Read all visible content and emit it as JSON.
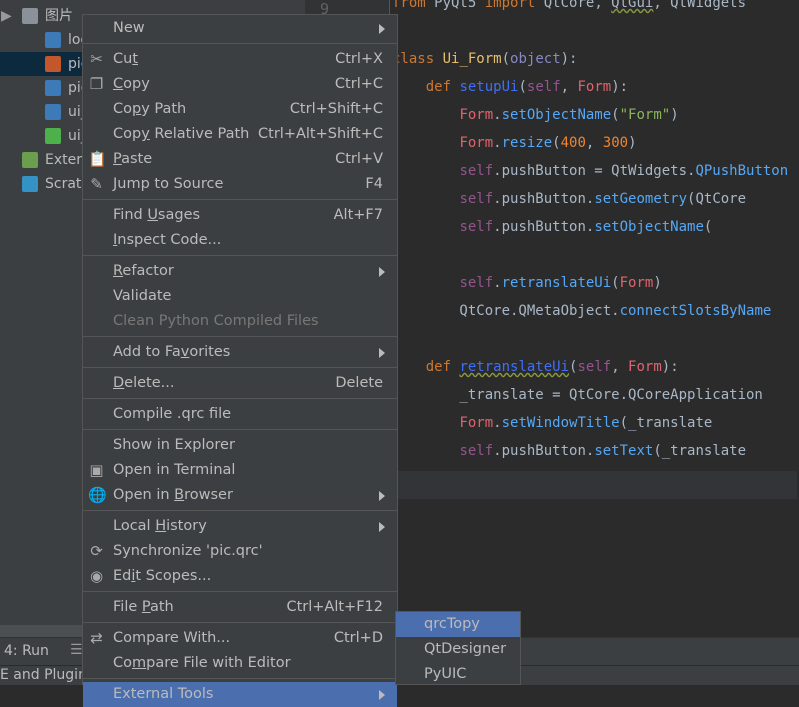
{
  "tree": {
    "items": [
      {
        "label": "图片",
        "icon": "folder-icon",
        "indent": 22
      },
      {
        "label": "logic_",
        "icon": "python-file-icon",
        "indent": 45
      },
      {
        "label": "pic.qrc",
        "icon": "qrc-file-icon",
        "indent": 45,
        "selected": true
      },
      {
        "label": "pic_rc",
        "icon": "python-file-icon",
        "indent": 45
      },
      {
        "label": "ui_set",
        "icon": "python-file-icon",
        "indent": 45
      },
      {
        "label": "ui_set",
        "icon": "qt-ui-file-icon",
        "indent": 45
      },
      {
        "label": "External",
        "icon": "library-icon",
        "indent": 22
      },
      {
        "label": "Scratches",
        "icon": "scratches-icon",
        "indent": 22
      }
    ]
  },
  "editor": {
    "line_number": "9",
    "lines": [
      [
        [
          "from",
          "kw"
        ],
        [
          " PyQt5 ",
          ""
        ],
        [
          "import",
          "kw"
        ],
        [
          " QtCore, ",
          ""
        ],
        [
          "QtGui",
          "wavy"
        ],
        [
          ", QtWidgets",
          ""
        ]
      ],
      [],
      [
        [
          "class",
          "kw"
        ],
        [
          " ",
          ""
        ],
        [
          "Ui_Form",
          "cls"
        ],
        [
          "(",
          ""
        ],
        [
          "object",
          "ob"
        ],
        [
          "):",
          ""
        ]
      ],
      [
        [
          "    ",
          ""
        ],
        [
          "def",
          "kw"
        ],
        [
          " ",
          ""
        ],
        [
          "setupUi",
          "fn"
        ],
        [
          "(",
          ""
        ],
        [
          "self",
          "sf"
        ],
        [
          ", ",
          ""
        ],
        [
          "Form",
          "rd"
        ],
        [
          "):",
          ""
        ]
      ],
      [
        [
          "        ",
          ""
        ],
        [
          "Form",
          "rd"
        ],
        [
          ".",
          ""
        ],
        [
          "setObjectName",
          "mt"
        ],
        [
          "(",
          ""
        ],
        [
          "\"Form\"",
          "st"
        ],
        [
          ")",
          ""
        ]
      ],
      [
        [
          "        ",
          ""
        ],
        [
          "Form",
          "rd"
        ],
        [
          ".",
          ""
        ],
        [
          "resize",
          "mt"
        ],
        [
          "(",
          ""
        ],
        [
          "400",
          "nm"
        ],
        [
          ", ",
          ""
        ],
        [
          "300",
          "nm"
        ],
        [
          ")",
          ""
        ]
      ],
      [
        [
          "        ",
          ""
        ],
        [
          "self",
          "sf"
        ],
        [
          ".pushButton = QtWidgets.",
          ""
        ],
        [
          "QPushButton",
          "mt"
        ]
      ],
      [
        [
          "        ",
          ""
        ],
        [
          "self",
          "sf"
        ],
        [
          ".pushButton.",
          ""
        ],
        [
          "setGeometry",
          "mt"
        ],
        [
          "(QtCore",
          ""
        ]
      ],
      [
        [
          "        ",
          ""
        ],
        [
          "self",
          "sf"
        ],
        [
          ".pushButton.",
          ""
        ],
        [
          "setObjectName",
          "mt"
        ],
        [
          "(",
          ""
        ]
      ],
      [],
      [
        [
          "        ",
          ""
        ],
        [
          "self",
          "sf"
        ],
        [
          ".",
          ""
        ],
        [
          "retranslateUi",
          "mt"
        ],
        [
          "(",
          ""
        ],
        [
          "Form",
          "rd"
        ],
        [
          ")",
          ""
        ]
      ],
      [
        [
          "        QtCore.QMetaObject.",
          ""
        ],
        [
          "connectSlotsByName",
          "mt"
        ]
      ],
      [],
      [
        [
          "    ",
          ""
        ],
        [
          "def",
          "kw"
        ],
        [
          " ",
          ""
        ],
        [
          "retranslateUi",
          "fn wavy"
        ],
        [
          "(",
          ""
        ],
        [
          "self",
          "sf"
        ],
        [
          ", ",
          ""
        ],
        [
          "Form",
          "rd"
        ],
        [
          "):",
          ""
        ]
      ],
      [
        [
          "        _translate = QtCore.QCoreApplication",
          ""
        ]
      ],
      [
        [
          "        ",
          ""
        ],
        [
          "Form",
          "rd"
        ],
        [
          ".",
          ""
        ],
        [
          "setWindowTitle",
          "mt"
        ],
        [
          "(_translate",
          ""
        ]
      ],
      [
        [
          "        ",
          ""
        ],
        [
          "self",
          "sf"
        ],
        [
          ".pushButton.",
          ""
        ],
        [
          "setText",
          "mt"
        ],
        [
          "(_translate",
          ""
        ]
      ],
      [
        [
          "",
          ""
        ]
      ]
    ]
  },
  "menu": {
    "items": [
      {
        "label": "New",
        "submenu": true,
        "sep_after": true
      },
      {
        "label": "Cut",
        "mn": 2,
        "shortcut": "Ctrl+X",
        "icon": "scissors-icon",
        "glyph": "✂"
      },
      {
        "label": "Copy",
        "mn": 0,
        "shortcut": "Ctrl+C",
        "icon": "copy-icon",
        "glyph": "❐"
      },
      {
        "label": "Copy Path",
        "mn": 2,
        "shortcut": "Ctrl+Shift+C"
      },
      {
        "label": "Copy Relative Path",
        "mn": 3,
        "shortcut": "Ctrl+Alt+Shift+C"
      },
      {
        "label": "Paste",
        "mn": 0,
        "shortcut": "Ctrl+V",
        "icon": "clipboard-icon",
        "glyph": "📋"
      },
      {
        "label": "Jump to Source",
        "shortcut": "F4",
        "icon": "pencil-icon",
        "glyph": "✎",
        "sep_after": true
      },
      {
        "label": "Find Usages",
        "mn": 5,
        "shortcut": "Alt+F7"
      },
      {
        "label": "Inspect Code...",
        "mn": 0,
        "sep_after": true
      },
      {
        "label": "Refactor",
        "mn": 0,
        "submenu": true
      },
      {
        "label": "Validate"
      },
      {
        "label": "Clean Python Compiled Files",
        "disabled": true,
        "sep_after": true
      },
      {
        "label": "Add to Favorites",
        "mn": 9,
        "submenu": true,
        "sep_after": true
      },
      {
        "label": "Delete...",
        "mn": 0,
        "shortcut": "Delete",
        "sep_after": true
      },
      {
        "label": "Compile .qrc file",
        "sep_after": true
      },
      {
        "label": "Show in Explorer"
      },
      {
        "label": "Open in Terminal",
        "icon": "terminal-icon",
        "glyph": "▣"
      },
      {
        "label": "Open in Browser",
        "mn": 8,
        "submenu": true,
        "icon": "globe-icon",
        "glyph": "🌐",
        "sep_after": true
      },
      {
        "label": "Local History",
        "mn": 6,
        "submenu": true
      },
      {
        "label": "Synchronize 'pic.qrc'",
        "icon": "sync-icon",
        "glyph": "⟳"
      },
      {
        "label": "Edit Scopes...",
        "mn": 2,
        "icon": "scope-icon",
        "glyph": "◉",
        "sep_after": true
      },
      {
        "label": "File Path",
        "mn": 5,
        "shortcut": "Ctrl+Alt+F12",
        "sep_after": true
      },
      {
        "label": "Compare With...",
        "shortcut": "Ctrl+D",
        "icon": "compare-icon",
        "glyph": "⇄"
      },
      {
        "label": "Compare File with Editor",
        "mn": 2,
        "sep_after": true
      },
      {
        "label": "External Tools",
        "submenu": true,
        "highlighted": true
      }
    ]
  },
  "submenu": {
    "items": [
      {
        "label": "qrcTopy",
        "highlighted": true
      },
      {
        "label": "QtDesigner"
      },
      {
        "label": "PyUIC"
      }
    ]
  },
  "bottom": {
    "run_label": "4: Run",
    "status_text": "E and Plugin"
  },
  "colors": {
    "menu_bg": "#3c3f41",
    "selection": "#4b6eaf",
    "editor_bg": "#2b2b2b"
  }
}
